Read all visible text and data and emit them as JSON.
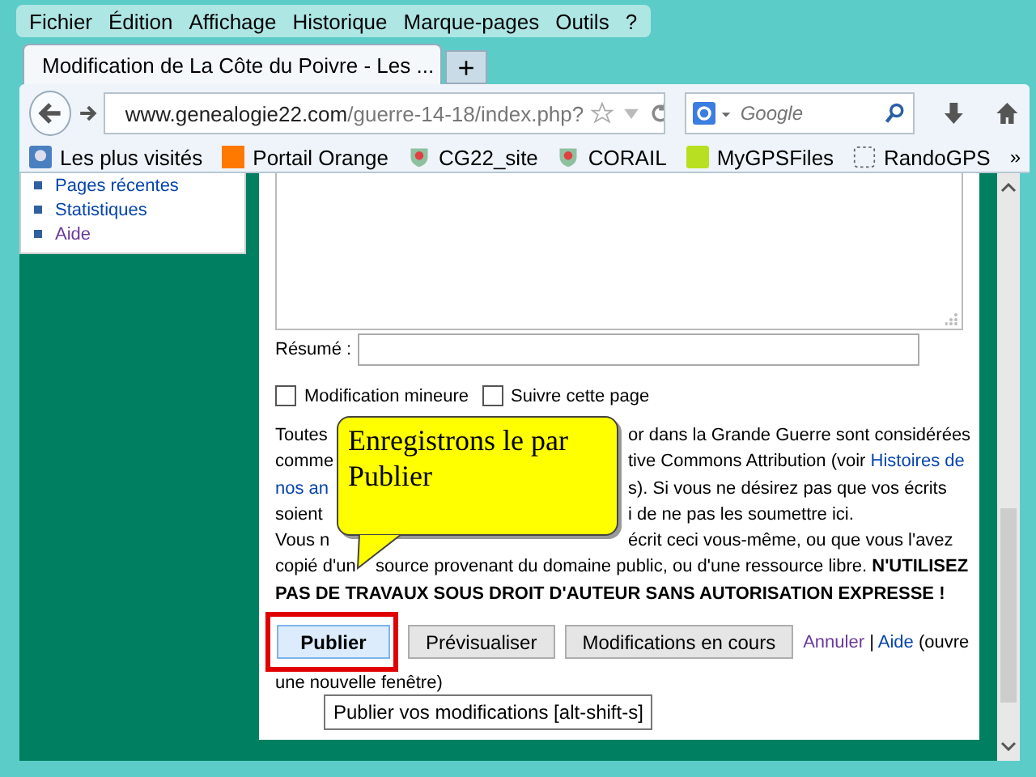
{
  "menu_bar": [
    "Fichier",
    "Édition",
    "Affichage",
    "Historique",
    "Marque-pages",
    "Outils",
    "?"
  ],
  "tabs": [
    {
      "label": "Modification de La Côte du Poivre - Les ...",
      "selected": true
    }
  ],
  "new_tab": "+",
  "address_bar": {
    "domain": "www.genealogie22.com",
    "path": "/guerre-14-18/index.php?"
  },
  "search": {
    "placeholder": "Google"
  },
  "bookmarks": [
    {
      "label": "Les plus visités",
      "kind": "search"
    },
    {
      "label": "Portail Orange",
      "kind": "orange"
    },
    {
      "label": "CG22_site",
      "kind": "crest"
    },
    {
      "label": "CORAIL",
      "kind": "crest"
    },
    {
      "label": "MyGPSFiles",
      "kind": "gps"
    },
    {
      "label": "RandoGPS",
      "kind": "blank"
    }
  ],
  "bookmarks_more": "»",
  "sidebar": {
    "items": [
      {
        "label": "Pages récentes",
        "visited": false
      },
      {
        "label": "Statistiques",
        "visited": false
      },
      {
        "label": "Aide",
        "visited": true
      }
    ]
  },
  "editor": {
    "summary_label": "Résumé :",
    "checkboxes": [
      {
        "label": "Modification mineure",
        "checked": false
      },
      {
        "label": "Suivre cette page",
        "checked": false
      }
    ],
    "license_lines": [
      {
        "left": "Toutes",
        "right": "or dans la Grande Guerre sont considérées"
      },
      {
        "left": "comme",
        "right": "tive Commons Attribution (voir ",
        "link": "Histoires de"
      },
      {
        "left_link": "nos an",
        "right": "s). Si vous ne désirez pas que vos écrits"
      },
      {
        "left": "soient",
        "right": "i de ne pas les soumettre ici."
      },
      {
        "left": "Vous n",
        "right": "écrit ceci vous-même, ou que vous l'avez"
      },
      {
        "left": "copié d'un",
        "right": "source provenant du domaine public, ou d'une ressource libre. **N'UTILISEZ**"
      },
      {
        "right": "**PAS DE TRAVAUX SOUS DROIT D'AUTEUR SANS AUTORISATION EXPRESSE !**"
      }
    ],
    "buttons": [
      {
        "label": "Publier",
        "primary": true
      },
      {
        "label": "Prévisualiser",
        "primary": false
      },
      {
        "label": "Modifications en cours",
        "primary": false
      }
    ],
    "cancel_link": "Annuler",
    "separator": "|",
    "help_link": "Aide",
    "help_note": "(ouvre",
    "help_note_cont": "une nouvelle fenêtre)",
    "tooltip": "Publier vos modifications [alt-shift-s]"
  },
  "callout": "Enregistrons le par Publier"
}
